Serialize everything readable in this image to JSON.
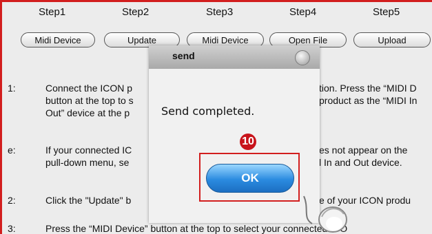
{
  "steps": [
    "Step1",
    "Step2",
    "Step3",
    "Step4",
    "Step5"
  ],
  "toolbar": {
    "midi_device": "Midi Device",
    "update": "Update",
    "midi_device_2": "Midi Device",
    "open_file": "Open File",
    "upload": "Upload"
  },
  "instructions": {
    "n1": "1:",
    "l1a": "Connect the ICON p",
    "l1b": "tion. Press the “MIDI D",
    "l2a": "button at the top to s",
    "l2b": "product as the “MIDI In",
    "l3a": "Out” device at the p",
    "ne": "e:",
    "l4a": "If your connected IC",
    "l4b": "es not appear on the",
    "l5a": "pull-down menu, se",
    "l5b": "l In and Out device.",
    "n2": "2:",
    "l6a": "Click the \"Update\" b",
    "l6b": "e of your ICON   produ",
    "n3": "3:",
    "l7": "Press the “MIDI Device” button at the top to select your connected ICO"
  },
  "dialog": {
    "title": "send",
    "message": "Send completed.",
    "ok_label": "OK"
  },
  "badge": "10",
  "colors": {
    "highlight": "#d21e1e",
    "ok_blue": "#2b8be0",
    "badge": "#c8141b"
  }
}
